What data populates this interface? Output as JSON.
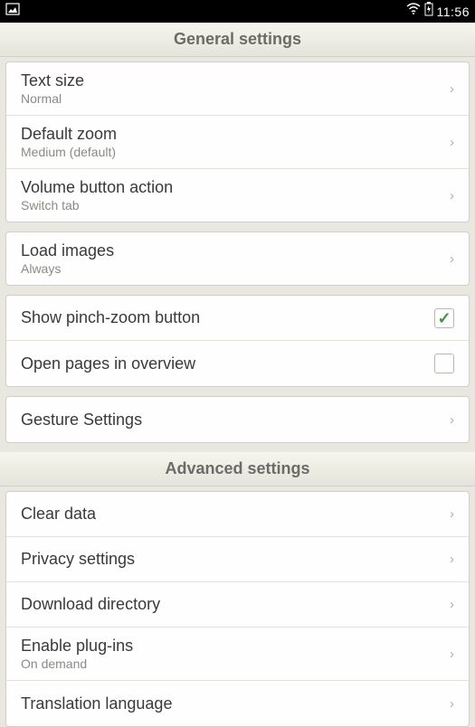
{
  "status": {
    "time": "11:56"
  },
  "sections": {
    "general": {
      "title": "General settings"
    },
    "advanced": {
      "title": "Advanced settings"
    }
  },
  "general": {
    "textSize": {
      "title": "Text size",
      "value": "Normal"
    },
    "defaultZoom": {
      "title": "Default zoom",
      "value": "Medium (default)"
    },
    "volumeAction": {
      "title": "Volume button action",
      "value": "Switch tab"
    },
    "loadImages": {
      "title": "Load images",
      "value": "Always"
    },
    "pinchZoom": {
      "title": "Show pinch-zoom button",
      "checked": true
    },
    "overview": {
      "title": "Open pages in overview",
      "checked": false
    },
    "gesture": {
      "title": "Gesture Settings"
    }
  },
  "advanced": {
    "clearData": {
      "title": "Clear data"
    },
    "privacy": {
      "title": "Privacy settings"
    },
    "download": {
      "title": "Download directory"
    },
    "plugins": {
      "title": "Enable plug-ins",
      "value": "On demand"
    },
    "translation": {
      "title": "Translation language"
    }
  }
}
